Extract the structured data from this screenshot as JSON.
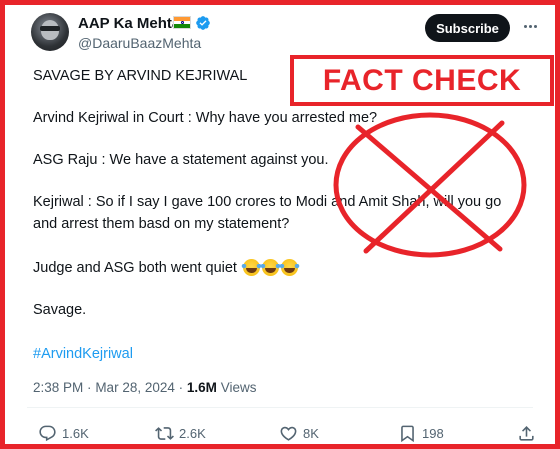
{
  "tweet": {
    "author": {
      "display_name": "AAP Ka Mehta",
      "handle": "@DaaruBaazMehta",
      "flag_icon": "india-flag-icon",
      "verified_icon": "verified-badge-icon",
      "verified_color": "#1d9bf0"
    },
    "subscribe_label": "Subscribe",
    "more_icon": "more-options-icon",
    "lines": {
      "l1": "SAVAGE BY ARVIND KEJRIWAL",
      "l2": "Arvind Kejriwal in Court : Why have you arrested me?",
      "l3": "ASG  Raju : We have a statement against you.",
      "l4": "Kejriwal : So if I say I gave 100 crores to Modi and Amit Shah, will you go",
      "l5": "and arrest them basd on my statement?",
      "l6": "Judge and ASG both went quiet",
      "l6_emoji": "laughing-with-tears-emoji",
      "l6_emoji_count": 3,
      "l7": "Savage.",
      "hashtag": "#ArvindKejriwal"
    },
    "meta": {
      "time": "2:38 PM",
      "separator": "·",
      "date": "Mar 28, 2024",
      "separator2": "·",
      "views_count": "1.6M",
      "views_label": "Views"
    },
    "actions": {
      "reply": {
        "icon": "reply-icon",
        "count": "1.6K"
      },
      "repost": {
        "icon": "repost-icon",
        "count": "2.6K"
      },
      "like": {
        "icon": "heart-icon",
        "count": "8K"
      },
      "bookmark": {
        "icon": "bookmark-icon",
        "count": "198"
      },
      "share": {
        "icon": "share-icon"
      }
    }
  },
  "overlay": {
    "fact_check_label": "FACT CHECK",
    "cross_icon": "red-cross-mark-icon",
    "accent_color": "#e8242a"
  },
  "colors": {
    "text": "#0f1419",
    "secondary_text": "#536471",
    "link": "#1d9bf0",
    "frame": "#e8242a"
  }
}
